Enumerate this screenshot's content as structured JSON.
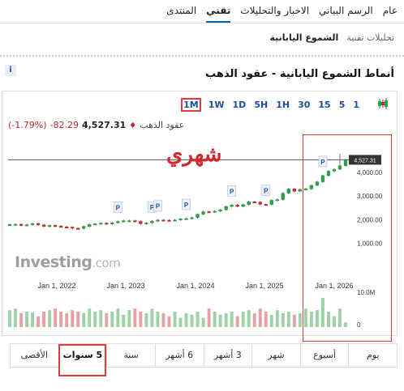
{
  "nav": {
    "items": [
      "عام",
      "الرسم البياني",
      "الاخبار والتحليلات",
      "تقني",
      "المنتدى"
    ],
    "active_index": 3
  },
  "subnav": {
    "crumb": "تحليلات تقنية",
    "current": "الشموع اليابانية"
  },
  "info_label": "i",
  "page_title": "أنماط الشموع اليابانية - عقود الذهب",
  "timeframes": [
    "1M",
    "1W",
    "1D",
    "5H",
    "1H",
    "30",
    "15",
    "5",
    "1"
  ],
  "selected_timeframe": "1M",
  "quote": {
    "name": "عقود الذهب",
    "price": "4,527.31",
    "change": "-82.29",
    "change_pct": "(-1.79%)"
  },
  "annotation": "شهري",
  "watermark": {
    "main": "Investing",
    "suffix": ".com"
  },
  "range_tabs": [
    "يوم",
    "أسبوع",
    "شهر",
    "3 أشهر",
    "6 أشهر",
    "سنة",
    "5 سنوات",
    "الأقصى"
  ],
  "selected_range": "5 سنوات",
  "chart_data": {
    "type": "candlestick",
    "x_tick_labels": [
      "Jan 1, 2022",
      "Jan 1, 2023",
      "Jan 1, 2024",
      "Jan 1, 2025",
      "Jan 1, 2026"
    ],
    "y_tick_labels": [
      "4,000.00",
      "3,000.00",
      "2,000.00",
      "1,000.00"
    ],
    "y_ticks": [
      4000,
      3000,
      2000,
      1000
    ],
    "ylim": [
      0,
      5600
    ],
    "last_price_label": "4,527.31",
    "last_price": 4527.31,
    "volume_axis_labels": [
      "10.0M",
      "0"
    ],
    "pattern_markers": [
      "P",
      "P",
      "P",
      "P",
      "P",
      "P",
      "P"
    ],
    "close": [
      1800,
      1810,
      1760,
      1790,
      1840,
      1780,
      1720,
      1760,
      1730,
      1700,
      1690,
      1640,
      1630,
      1720,
      1800,
      1830,
      1860,
      1820,
      1870,
      1930,
      1960,
      1960,
      1930,
      1830,
      1870,
      1940,
      1990,
      1980,
      1970,
      1990,
      2040,
      2050,
      2090,
      2230,
      2340,
      2330,
      2360,
      2420,
      2560,
      2620,
      2560,
      2640,
      2760,
      2740,
      2650,
      2640,
      2820,
      2850,
      3120,
      3300,
      3200,
      3280,
      3300,
      3450,
      3600,
      3860,
      4050,
      4130,
      4280,
      4527
    ],
    "volume_pct": [
      0.55,
      0.6,
      0.45,
      0.5,
      0.48,
      0.35,
      0.5,
      0.55,
      0.6,
      0.5,
      0.45,
      0.55,
      0.5,
      0.45,
      0.6,
      0.5,
      0.55,
      0.45,
      0.5,
      0.6,
      0.4,
      0.55,
      0.6,
      0.5,
      0.45,
      0.6,
      0.5,
      0.45,
      0.35,
      0.5,
      0.3,
      0.45,
      0.4,
      0.5,
      0.3,
      0.6,
      0.5,
      0.4,
      0.45,
      0.5,
      0.35,
      0.5,
      0.55,
      0.45,
      0.6,
      0.5,
      0.4,
      0.55,
      0.45,
      0.5,
      0.4,
      0.45,
      0.6,
      0.5,
      0.55,
      0.95,
      0.5,
      0.35,
      0.6,
      0.15
    ]
  }
}
